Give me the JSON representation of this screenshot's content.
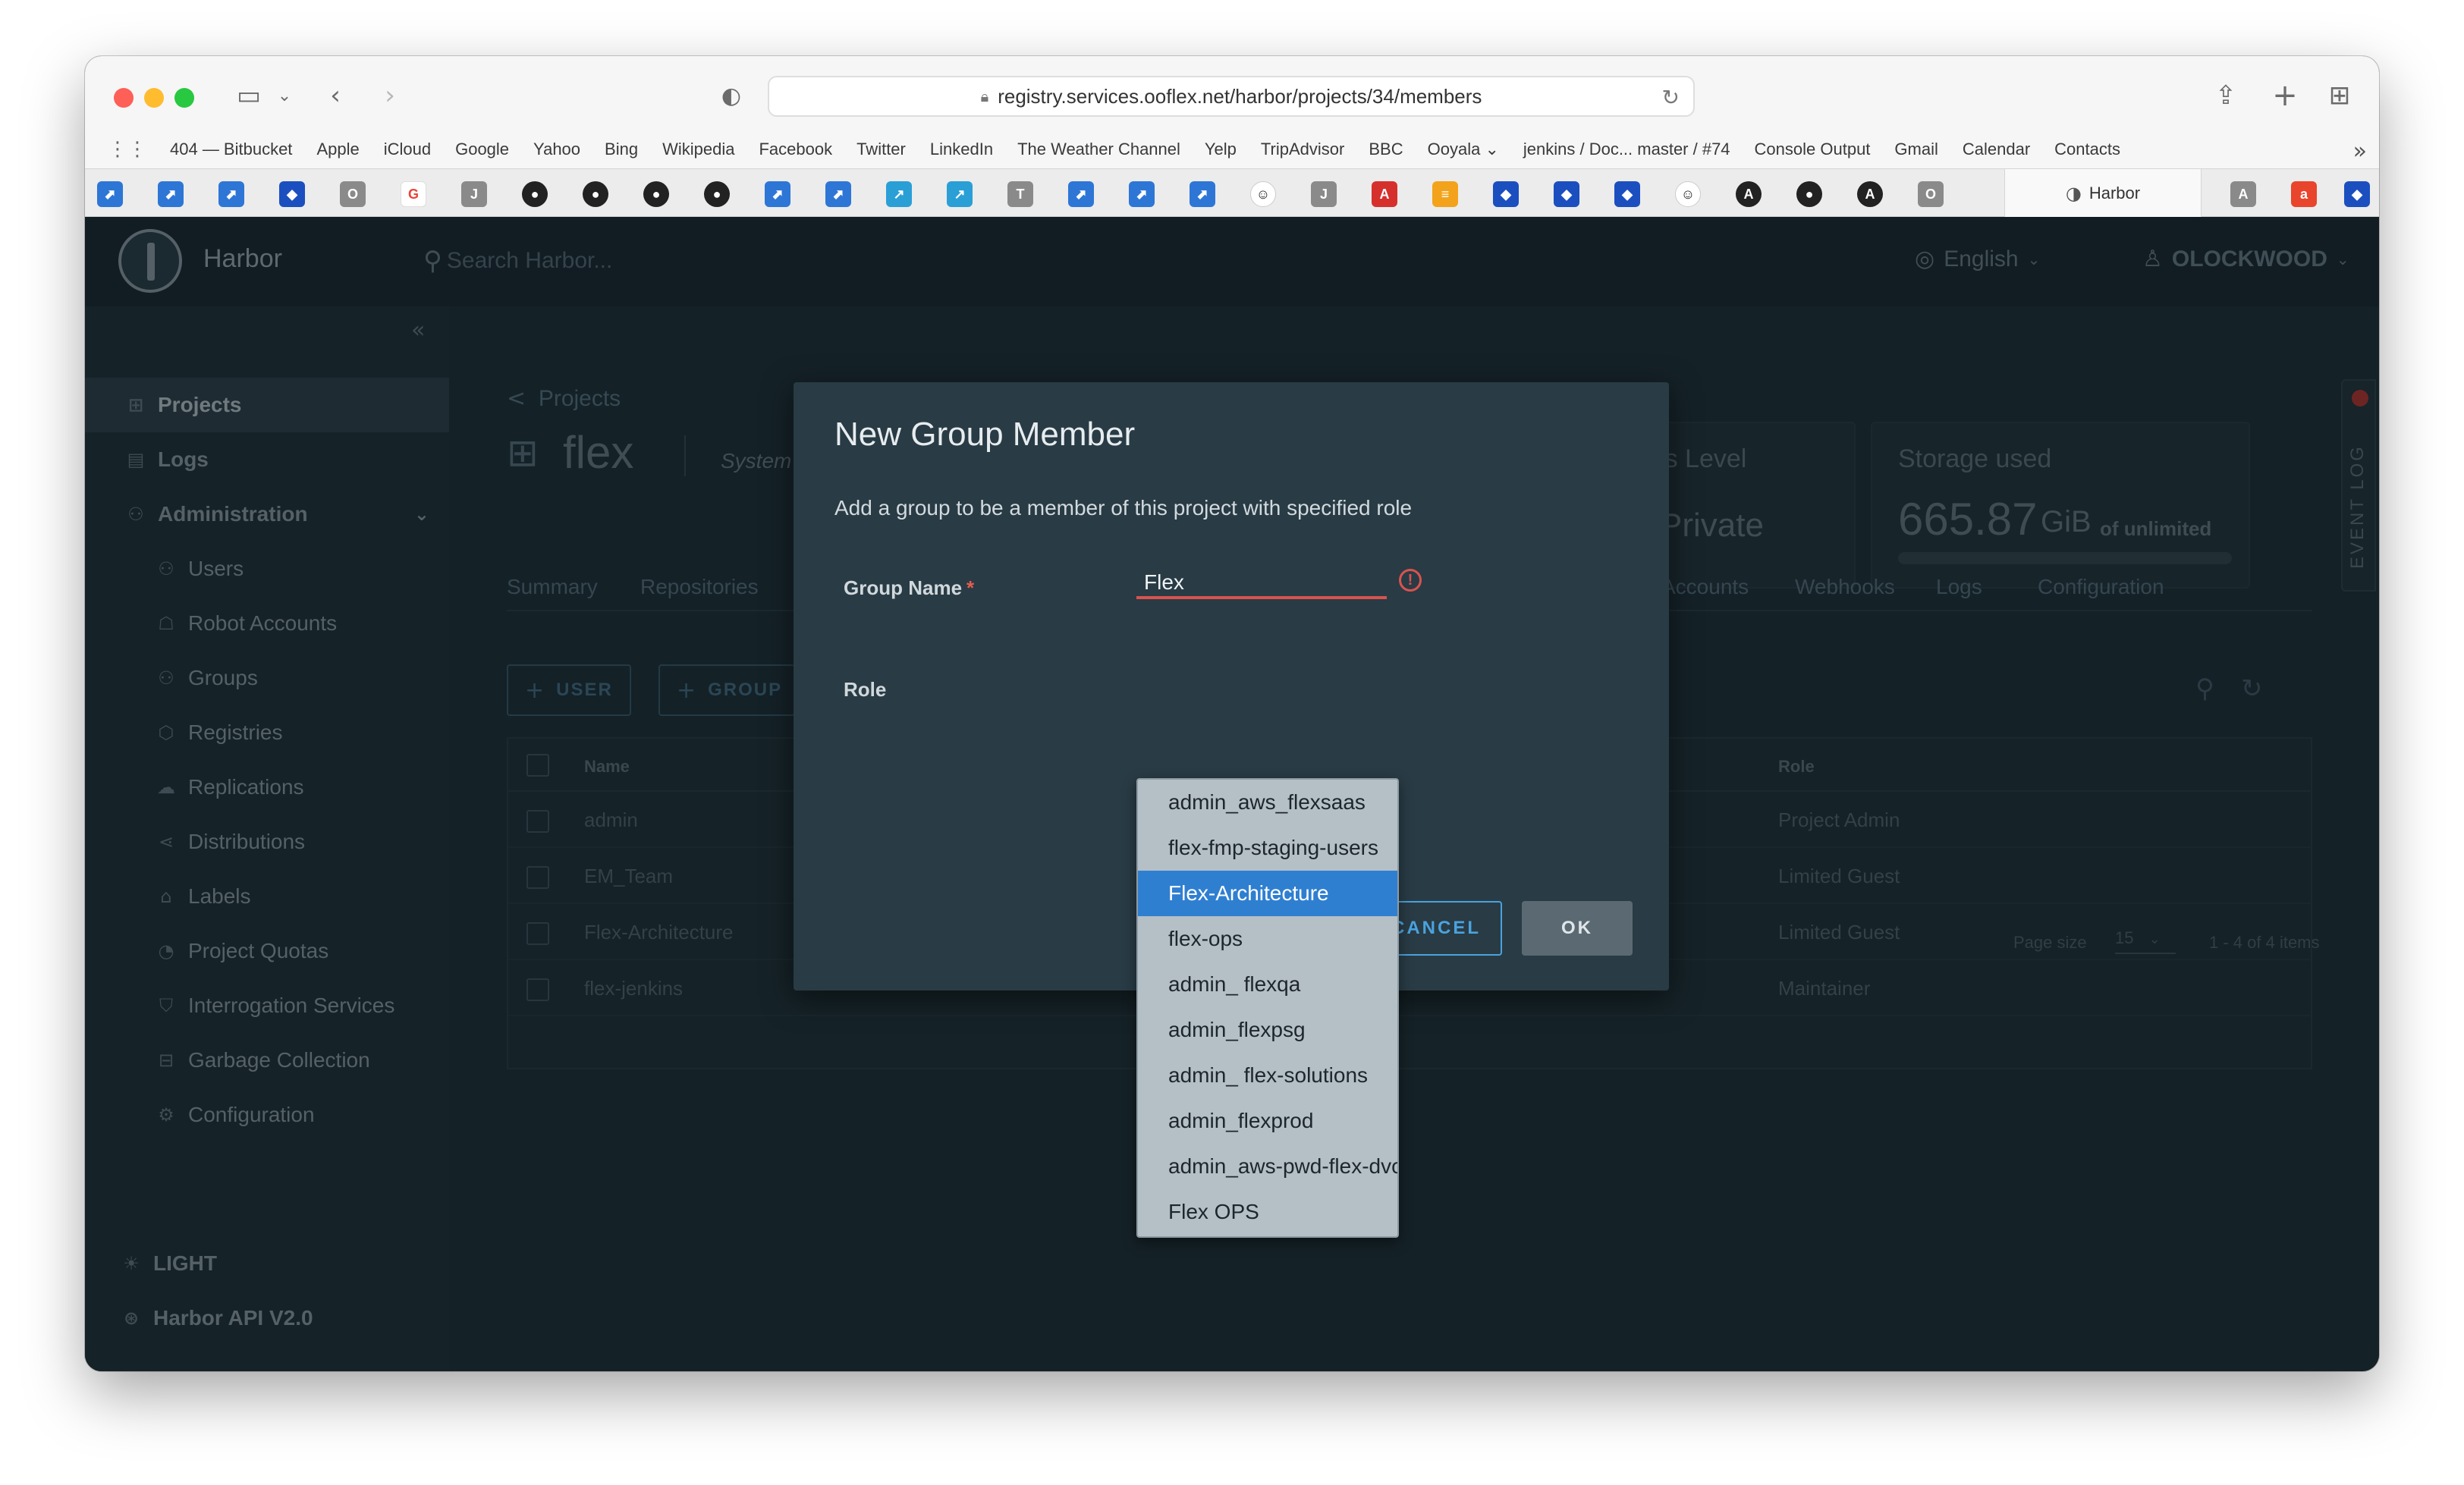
{
  "browser": {
    "url": "registry.services.ooflex.net/harbor/projects/34/members",
    "favorites": [
      "404 — Bitbucket",
      "Apple",
      "iCloud",
      "Google",
      "Yahoo",
      "Bing",
      "Wikipedia",
      "Facebook",
      "Twitter",
      "LinkedIn",
      "The Weather Channel",
      "Yelp",
      "TripAdvisor",
      "BBC",
      "Ooyala",
      "jenkins / Doc... master / #74",
      "Console Output",
      "Gmail",
      "Calendar",
      "Contacts"
    ],
    "active_tab": "Harbor",
    "colors": {
      "close": "#fe5f57",
      "minimize": "#febc2e",
      "zoom": "#28c840"
    }
  },
  "header": {
    "brand": "Harbor",
    "search_placeholder": "Search Harbor...",
    "language": "English",
    "user": "OLOCKWOOD"
  },
  "sidebar": {
    "items": [
      {
        "label": "Projects",
        "icon": "projects-icon"
      },
      {
        "label": "Logs",
        "icon": "logs-icon"
      },
      {
        "label": "Administration",
        "icon": "admin-icon"
      },
      {
        "label": "Users",
        "icon": "users-icon"
      },
      {
        "label": "Robot Accounts",
        "icon": "robot-icon"
      },
      {
        "label": "Groups",
        "icon": "groups-icon"
      },
      {
        "label": "Registries",
        "icon": "registries-icon"
      },
      {
        "label": "Replications",
        "icon": "replications-icon"
      },
      {
        "label": "Distributions",
        "icon": "distributions-icon"
      },
      {
        "label": "Labels",
        "icon": "labels-icon"
      },
      {
        "label": "Project Quotas",
        "icon": "quotas-icon"
      },
      {
        "label": "Interrogation Services",
        "icon": "interrogation-icon"
      },
      {
        "label": "Garbage Collection",
        "icon": "trash-icon"
      },
      {
        "label": "Configuration",
        "icon": "config-icon"
      }
    ],
    "theme_toggle": "LIGHT",
    "api_link": "Harbor API V2.0"
  },
  "project": {
    "breadcrumb": "Projects",
    "name": "flex",
    "role": "System Admin",
    "access_level_title": "Access Level",
    "access_level_value": "Private",
    "storage_title": "Storage used",
    "storage_value": "665.87",
    "storage_unit": "GiB",
    "storage_limit": "of unlimited",
    "tabs": [
      "Summary",
      "Repositories",
      "Accounts",
      "Webhooks",
      "Logs",
      "Configuration"
    ]
  },
  "members": {
    "add_user": "USER",
    "add_group": "GROUP",
    "columns": {
      "name": "Name",
      "role": "Role"
    },
    "rows": [
      {
        "name": "admin",
        "role": "Project Admin"
      },
      {
        "name": "EM_Team",
        "role": "Limited Guest"
      },
      {
        "name": "Flex-Architecture",
        "role": "Limited Guest"
      },
      {
        "name": "flex-jenkins",
        "role": "Maintainer"
      }
    ],
    "page_size_label": "Page size",
    "page_size": "15",
    "range": "1 - 4 of 4 items"
  },
  "event_log": "EVENT LOG",
  "modal": {
    "title": "New Group Member",
    "description": "Add a group to be a member of this project with specified role",
    "group_name_label": "Group Name",
    "group_name_value": "Flex",
    "role_label": "Role",
    "cancel": "CANCEL",
    "ok": "OK",
    "suggestions": [
      "admin_aws_flexsaas",
      "flex-fmp-staging-users",
      "Flex-Architecture",
      "flex-ops",
      "admin_ flexqa",
      "admin_flexpsg",
      "admin_ flex-solutions",
      "admin_flexprod",
      "admin_aws-pwd-flex-dvc",
      "Flex OPS"
    ],
    "selected_suggestion": "Flex-Architecture",
    "colors": {
      "selected": "#2f7fd1",
      "error": "#d9534f",
      "cancel": "#4aa3df"
    }
  }
}
